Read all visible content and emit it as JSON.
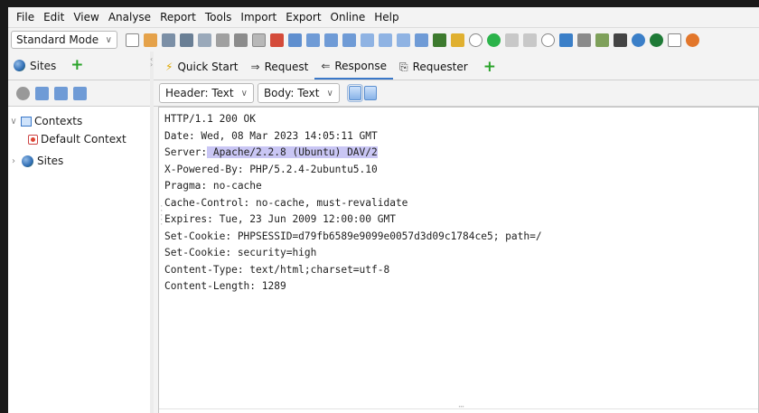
{
  "menu": [
    "File",
    "Edit",
    "View",
    "Analyse",
    "Report",
    "Tools",
    "Import",
    "Export",
    "Online",
    "Help"
  ],
  "toolbar": {
    "mode": "Standard Mode",
    "buttons": [
      {
        "icon": "new-session-icon",
        "color": "#ffffff",
        "border": "#888888"
      },
      {
        "icon": "open-session-icon",
        "color": "#e5a24a"
      },
      {
        "icon": "persist-session-icon",
        "color": "#7b8fa6"
      },
      {
        "icon": "snapshot-session-icon",
        "color": "#6a7f95"
      },
      {
        "icon": "session-properties-icon",
        "color": "#9aa9ba"
      },
      {
        "icon": "options-icon",
        "color": "#a0a0a0"
      },
      {
        "icon": "export-icon",
        "color": "#8c8c8c"
      },
      {
        "icon": "tab-layout-icon",
        "color": "#b8b8b8",
        "border": "#888888"
      },
      {
        "icon": "tab-layout-2-icon",
        "color": "#d44b3a"
      },
      {
        "icon": "layout-full-icon",
        "color": "#5f8fcf"
      },
      {
        "icon": "layout-horizontal-icon",
        "color": "#6f9bd6"
      },
      {
        "icon": "layout-vertical-icon",
        "color": "#6f9bd6"
      },
      {
        "icon": "layout-tabs-icon",
        "color": "#6f9bd6"
      },
      {
        "icon": "show-tabs-icon",
        "color": "#8fb3e3"
      },
      {
        "icon": "hide-tabs-icon",
        "color": "#8fb3e3"
      },
      {
        "icon": "pin-tabs-icon",
        "color": "#8fb3e3"
      },
      {
        "icon": "alerts-icon",
        "color": "#6f9bd6"
      },
      {
        "icon": "spider-icon",
        "color": "#3d7a2e"
      },
      {
        "icon": "scan-policy-icon",
        "color": "#e0b030"
      },
      {
        "icon": "break-icon",
        "color": "#ffffff",
        "border": "#888888",
        "round": true
      },
      {
        "icon": "break-all-icon",
        "color": "#2bb34a",
        "round": true
      },
      {
        "icon": "step-icon",
        "color": "#c8c8c8"
      },
      {
        "icon": "continue-icon",
        "color": "#c8c8c8"
      },
      {
        "icon": "drop-icon",
        "color": "#ffffff",
        "border": "#888888",
        "round": true
      },
      {
        "icon": "fuzzer-icon",
        "color": "#3b7fc8"
      },
      {
        "icon": "scan-icon",
        "color": "#8a8a8a"
      },
      {
        "icon": "tree-icon",
        "color": "#7ea05a"
      },
      {
        "icon": "terminal-icon",
        "color": "#444444"
      },
      {
        "icon": "hud-icon",
        "color": "#3b7fc8",
        "round": true
      },
      {
        "icon": "status-icon",
        "color": "#1e7a36",
        "round": true
      },
      {
        "icon": "notes-icon",
        "color": "#ffffff",
        "border": "#888888"
      },
      {
        "icon": "firefox-icon",
        "color": "#e2762a",
        "round": true
      }
    ]
  },
  "left": {
    "tab_label": "Sites",
    "tools": [
      {
        "icon": "show-all-icon",
        "color": "#999999"
      },
      {
        "icon": "export-tree-icon",
        "color": "#6f9bd6"
      },
      {
        "icon": "context-icon",
        "color": "#6f9bd6"
      },
      {
        "icon": "filter-icon",
        "color": "#6f9bd6"
      }
    ],
    "tree": {
      "contexts": "Contexts",
      "default_context": "Default Context",
      "sites": "Sites"
    }
  },
  "tabs": [
    {
      "label": "Quick Start",
      "icon": "quick-start-icon",
      "glyph": "⚡"
    },
    {
      "label": "Request",
      "icon": "request-arrow-icon",
      "glyph": "⇒"
    },
    {
      "label": "Response",
      "icon": "response-arrow-icon",
      "glyph": "⇐",
      "active": true
    },
    {
      "label": "Requester",
      "icon": "requester-icon",
      "glyph": "⎘"
    }
  ],
  "viewbar": {
    "header_select": "Header: Text",
    "body_select": "Body: Text"
  },
  "response_lines": [
    "HTTP/1.1 200 OK",
    "Date: Wed, 08 Mar 2023 14:05:11 GMT",
    "Server: Apache/2.2.8 (Ubuntu) DAV/2",
    "X-Powered-By: PHP/5.2.4-2ubuntu5.10",
    "Pragma: no-cache",
    "Cache-Control: no-cache, must-revalidate",
    "Expires: Tue, 23 Jun 2009 12:00:00 GMT",
    "Set-Cookie: PHPSESSID=d79fb6589e9099e0057d3d09c1784ce5; path=/",
    "Set-Cookie: security=high",
    "Content-Type: text/html;charset=utf-8",
    "Content-Length: 1289"
  ],
  "highlight": {
    "line": 2,
    "before": "Server:",
    "selected": " Apache/2.2.8 (Ubuntu) DAV/2"
  }
}
